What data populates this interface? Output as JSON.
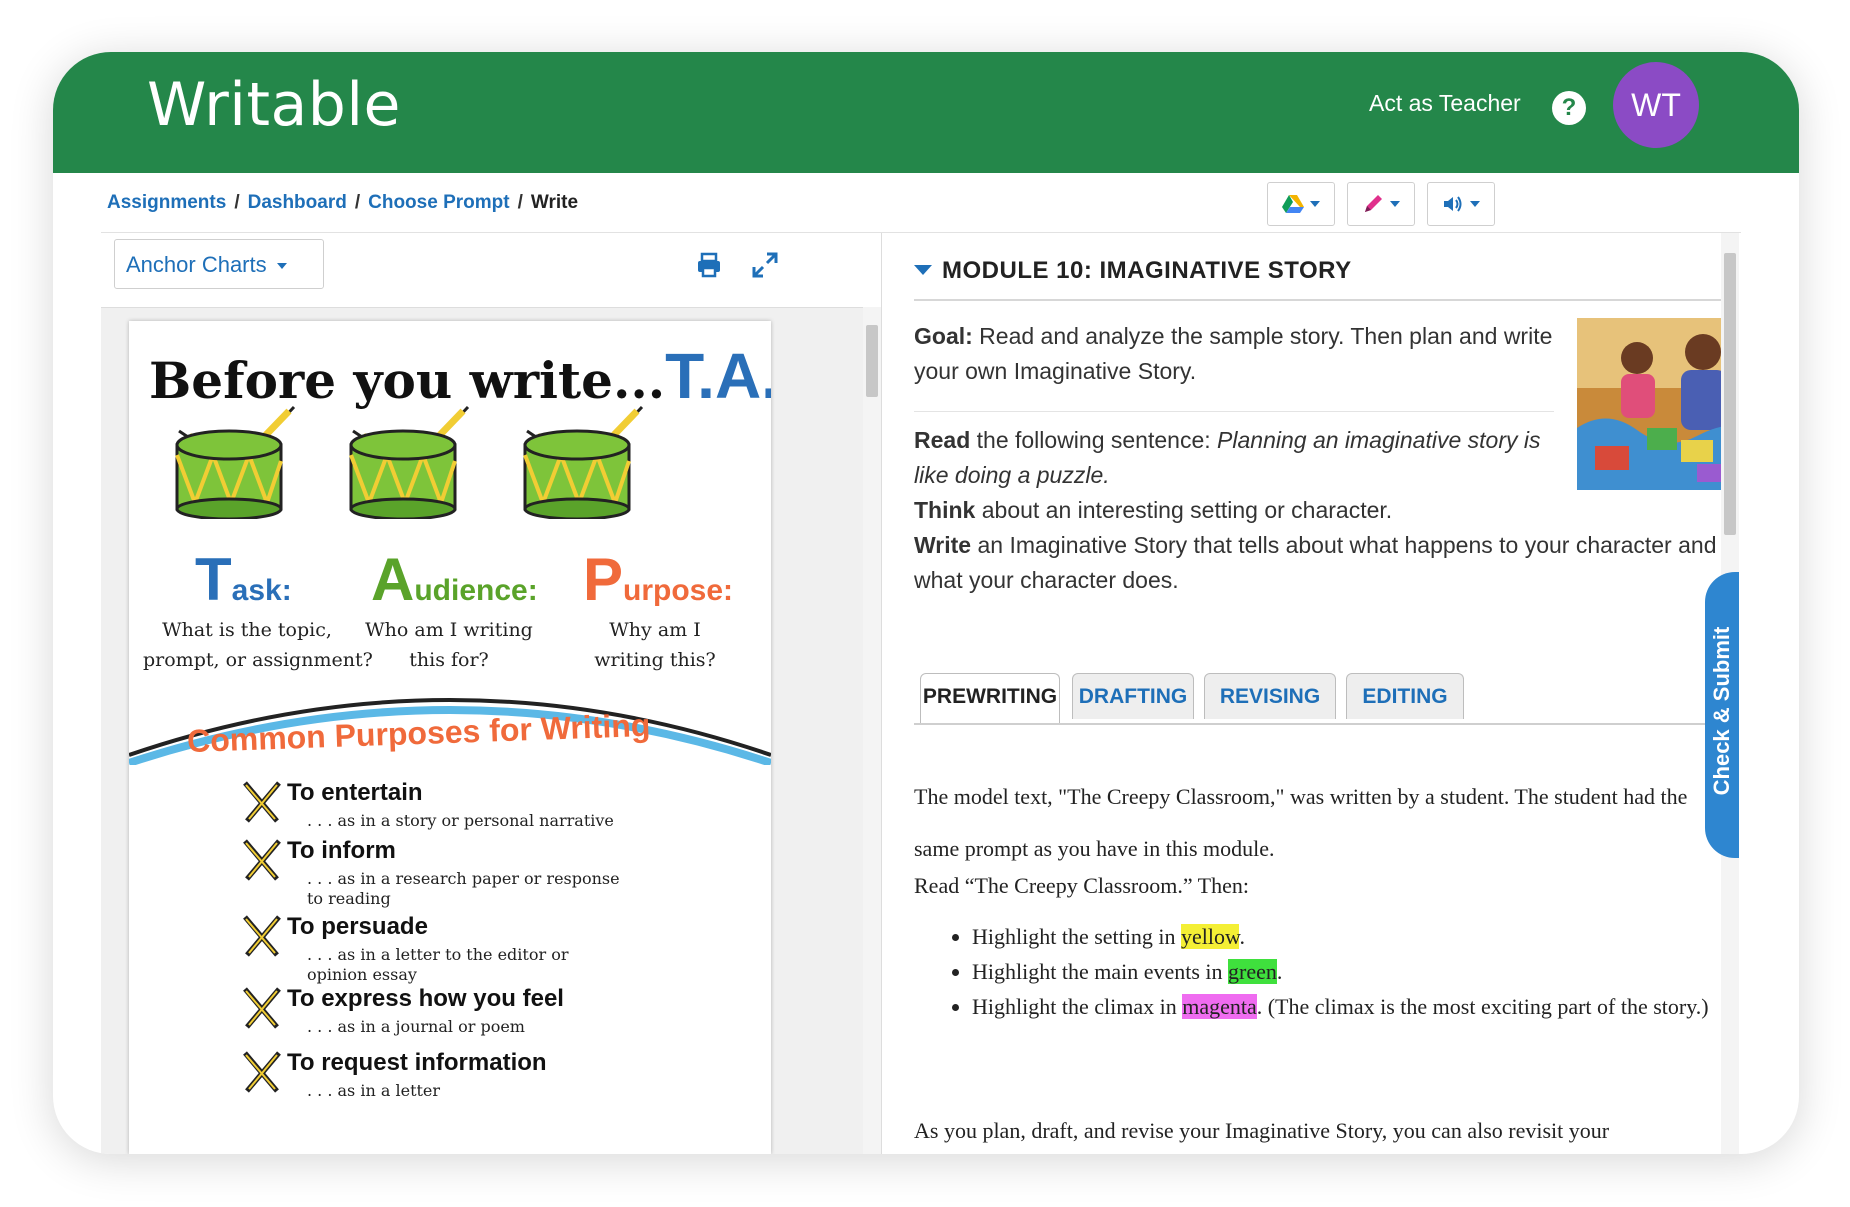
{
  "app": {
    "logo": "Writable",
    "act_as": "Act as Teacher",
    "help_icon": "question-circle-icon",
    "avatar_initials": "WT",
    "colors": {
      "header": "#24874a",
      "link": "#1e6fb8",
      "avatar": "#8b4bc5",
      "submit": "#2e86d0"
    }
  },
  "breadcrumb": {
    "items": [
      "Assignments",
      "Dashboard",
      "Choose Prompt"
    ],
    "current": "Write",
    "separator": "/"
  },
  "toolbar": {
    "icons": [
      "google-drive-icon",
      "highlighter-pen-icon",
      "speaker-icon"
    ]
  },
  "left": {
    "dropdown_label": "Anchor Charts",
    "icons": [
      "print-icon",
      "expand-icon"
    ],
    "chart": {
      "title": "Before you write...",
      "title_acronym": "T.A.P.",
      "columns": [
        {
          "letter": "T",
          "word": "ask:",
          "q1": "What is the topic,",
          "q2": "prompt, or assignment?",
          "color": "#2a6fb8"
        },
        {
          "letter": "A",
          "word": "udience:",
          "q1": "Who am I writing",
          "q2": "this for?",
          "color": "#5aa32a"
        },
        {
          "letter": "P",
          "word": "urpose:",
          "q1": "Why am I",
          "q2": "writing this?",
          "color": "#f06a3b"
        }
      ],
      "banner": "Common Purposes for Writing",
      "purposes": [
        {
          "name": "To entertain",
          "l1": ". . . as in a story or personal narrative",
          "l2": ""
        },
        {
          "name": "To inform",
          "l1": ". . . as in a research paper or response",
          "l2": "to reading"
        },
        {
          "name": "To persuade",
          "l1": ". . . as in a letter to the editor or",
          "l2": "opinion essay"
        },
        {
          "name": "To express how you feel",
          "l1": ". . . as in a journal or poem",
          "l2": ""
        },
        {
          "name": "To request information",
          "l1": ". . . as in a letter",
          "l2": ""
        }
      ]
    }
  },
  "right": {
    "module_title": "MODULE 10: IMAGINATIVE STORY",
    "goal_label": "Goal:",
    "goal_text": " Read and analyze the sample story. Then plan and write your own Imaginative Story.",
    "read_label": "Read",
    "read_text": " the following sentence: ",
    "read_quote": "Planning an imaginative story is like doing a puzzle.",
    "think_label": "Think",
    "think_text": " about an interesting setting or character.",
    "write_label": "Write",
    "write_text": " an Imaginative Story that tells about what happens to your character and what your character does.",
    "tabs": [
      "PREWRITING",
      "DRAFTING",
      "REVISING",
      "EDITING"
    ],
    "active_tab": "PREWRITING",
    "history_icon": "clock-icon",
    "body_p1": "The model text, \"The Creepy Classroom,\" was written by a student. The student had the same prompt as you have in this module.",
    "body_p2": "Read “The Creepy Classroom.” Then:",
    "bullets": [
      {
        "pre": "Highlight the setting in ",
        "hl": "yellow",
        "post": "."
      },
      {
        "pre": "Highlight the main events in ",
        "hl": "green",
        "post": "."
      },
      {
        "pre": "Highlight the climax in ",
        "hl": "magenta",
        "post": ". (The climax is the most exciting part of the story.)"
      }
    ],
    "body_p3": "As you plan, draft, and revise your Imaginative Story, you can also revisit your",
    "submit_label": "Check & Submit"
  }
}
